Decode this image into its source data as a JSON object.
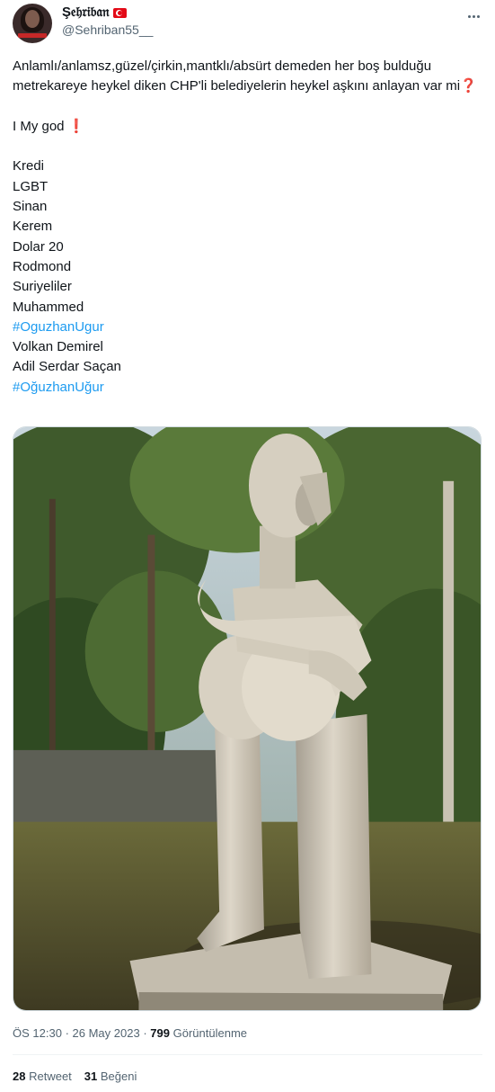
{
  "user": {
    "display_name": "Ş𝔢𝔥𝔯𝔦𝔟𝔞𝔫",
    "handle": "@Sehriban55__",
    "flag_icon": "turkey-flag-icon"
  },
  "tweet": {
    "line1": "Anlamlı/anlamsz,güzel/çirkin,mantklı/absürt demeden her boş bulduğu metrekareye heykel diken CHP'li belediyelerin heykel aşkını anlayan var mi",
    "question_emoji": "❓",
    "line2": "I My god",
    "exclamation_emoji": "❗",
    "items": [
      {
        "text": "Kredi",
        "hashtag": false
      },
      {
        "text": "LGBT",
        "hashtag": false
      },
      {
        "text": "Sinan",
        "hashtag": false
      },
      {
        "text": "Kerem",
        "hashtag": false
      },
      {
        "text": "Dolar 20",
        "hashtag": false
      },
      {
        "text": "Rodmond",
        "hashtag": false
      },
      {
        "text": "Suriyeliler",
        "hashtag": false
      },
      {
        "text": "Muhammed",
        "hashtag": false
      },
      {
        "text": "#OguzhanUgur",
        "hashtag": true
      },
      {
        "text": "Volkan Demirel",
        "hashtag": false
      },
      {
        "text": "Adil Serdar Saçan",
        "hashtag": false
      },
      {
        "text": "#OğuzhanUğur",
        "hashtag": true
      }
    ]
  },
  "meta": {
    "time": "ÖS 12:30",
    "separator": "·",
    "date": "26 May 2023",
    "views_count": "799",
    "views_label": "Görüntülenme"
  },
  "stats": {
    "retweets_count": "28",
    "retweets_label": "Retweet",
    "likes_count": "31",
    "likes_label": "Beğeni"
  }
}
